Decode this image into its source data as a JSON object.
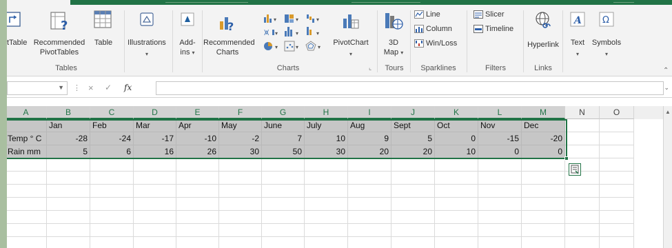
{
  "ribbon": {
    "tables": {
      "pivot_table_label": "tTable",
      "recommended_pivot_label_1": "Recommended",
      "recommended_pivot_label_2": "PivotTables",
      "table_label": "Table",
      "group_label": "Tables"
    },
    "illustrations": {
      "label": "Illustrations"
    },
    "addins": {
      "label_1": "Add-",
      "label_2": "ins"
    },
    "charts": {
      "recommended_label_1": "Recommended",
      "recommended_label_2": "Charts",
      "pivotchart_label": "PivotChart",
      "group_label": "Charts"
    },
    "tours": {
      "map_label_1": "3D",
      "map_label_2": "Map",
      "group_label": "Tours"
    },
    "sparklines": {
      "line_label": "Line",
      "column_label": "Column",
      "winloss_label": "Win/Loss",
      "group_label": "Sparklines"
    },
    "filters": {
      "slicer_label": "Slicer",
      "timeline_label": "Timeline",
      "group_label": "Filters"
    },
    "links": {
      "hyperlink_label": "Hyperlink",
      "group_label": "Links"
    },
    "text": {
      "label": "Text"
    },
    "symbols": {
      "label": "Symbols"
    }
  },
  "formula_bar": {
    "name_box_value": "",
    "formula_value": "",
    "fx_label": "fx",
    "cancel_glyph": "×",
    "enter_glyph": "✓"
  },
  "grid": {
    "columns": [
      "A",
      "B",
      "C",
      "D",
      "E",
      "F",
      "G",
      "H",
      "I",
      "J",
      "K",
      "L",
      "M",
      "N",
      "O"
    ],
    "rows": [
      [
        "",
        "Jan",
        "Feb",
        "Mar",
        "Apr",
        "May",
        "June",
        "July",
        "Aug",
        "Sept",
        "Oct",
        "Nov",
        "Dec"
      ],
      [
        "Temp ° C",
        "-28",
        "-24",
        "-17",
        "-10",
        "-2",
        "7",
        "10",
        "9",
        "5",
        "0",
        "-15",
        "-20"
      ],
      [
        "Rain mm",
        "5",
        "6",
        "16",
        "26",
        "30",
        "50",
        "30",
        "20",
        "20",
        "10",
        "0",
        "0"
      ]
    ]
  },
  "colors": {
    "accent": "#217346",
    "selection_fill": "#c6c6c6",
    "ribbon_bg": "#f3f3f3",
    "backdrop": "#a9bfa0"
  }
}
